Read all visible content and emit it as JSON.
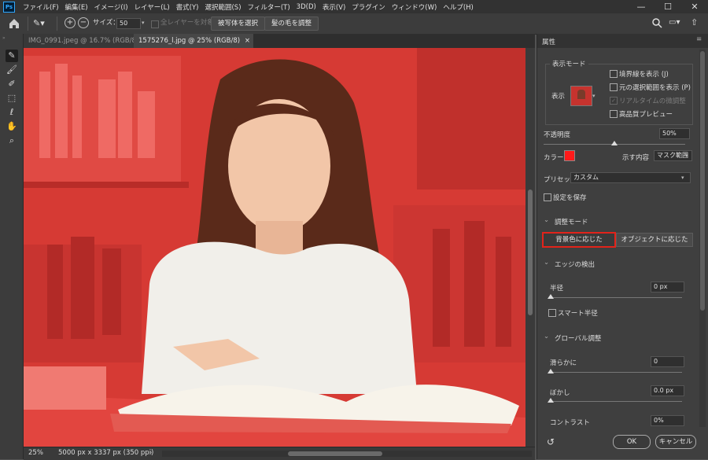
{
  "app": {
    "logo": "Ps"
  },
  "menu": [
    "ファイル(F)",
    "編集(E)",
    "イメージ(I)",
    "レイヤー(L)",
    "書式(Y)",
    "選択範囲(S)",
    "フィルター(T)",
    "3D(D)",
    "表示(V)",
    "プラグイン",
    "ウィンドウ(W)",
    "ヘルプ(H)"
  ],
  "window_controls": {
    "minimize": "—",
    "maximize": "☐",
    "close": "✕"
  },
  "options_bar": {
    "size_label": "サイズ：",
    "size_value": "50",
    "sample_all_layers": "全レイヤーを対象",
    "select_subject": "被写体を選択",
    "refine_hair": "髪の毛を調整"
  },
  "tabs": [
    {
      "label": "IMG_0991.jpeg @ 16.7% (RGB/8*) *",
      "close": "×"
    },
    {
      "label": "1575276_l.jpg @ 25% (RGB/8)",
      "close": "×"
    }
  ],
  "status": {
    "zoom": "25%",
    "info": "5000 px x 3337 px (350 ppi)"
  },
  "panel": {
    "title": "属性",
    "view_mode_legend": "表示モード",
    "view_label": "表示",
    "show_edge": "境界線を表示 (J)",
    "show_original": "元の選択範囲を表示 (P)",
    "realtime_adjust": "リアルタイムの微調整",
    "high_quality_preview": "高品質プレビュー",
    "opacity_label": "不透明度",
    "opacity_value": "50%",
    "opacity_level": 0.5,
    "color_label": "カラー",
    "color_hex": "#ff1a1a",
    "indicates_label": "示す内容",
    "indicates_value": "マスク範囲",
    "preset_label": "プリセット",
    "preset_value": "カスタム",
    "save_settings": "設定を保存",
    "adjust_mode": "調整モード",
    "color_aware": "背景色に応じた",
    "object_aware": "オブジェクトに応じた",
    "edge_detection": "エッジの検出",
    "radius_label": "半径",
    "radius_value": "0 px",
    "smart_radius": "スマート半径",
    "global_refinements": "グローバル調整",
    "smooth_label": "滑らかに",
    "smooth_value": "0",
    "feather_label": "ぼかし",
    "feather_value": "0.0 px",
    "contrast_label": "コントラスト",
    "contrast_value": "0%",
    "ok": "OK",
    "cancel": "キャンセル"
  },
  "colors": {
    "accent_red": "#e2231a",
    "overlay_red": "#d93a35"
  }
}
